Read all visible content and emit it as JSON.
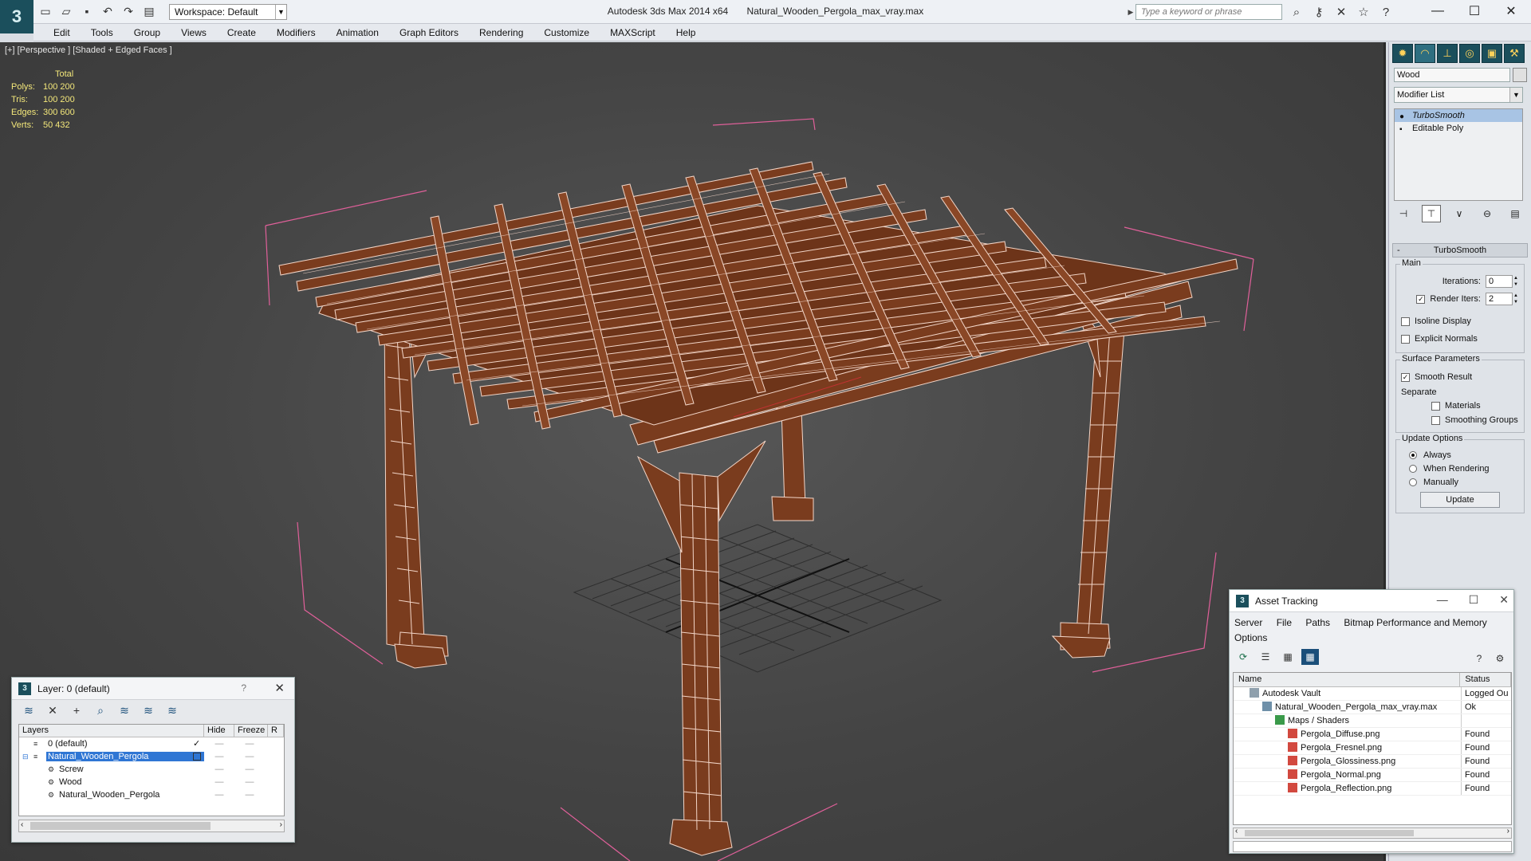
{
  "app": {
    "title": "Autodesk 3ds Max  2014 x64",
    "file_name": "Natural_Wooden_Pergola_max_vray.max",
    "workspace": "Workspace: Default",
    "search_placeholder": "Type a keyword or phrase"
  },
  "menu": [
    "Edit",
    "Tools",
    "Group",
    "Views",
    "Create",
    "Modifiers",
    "Animation",
    "Graph Editors",
    "Rendering",
    "Customize",
    "MAXScript",
    "Help"
  ],
  "viewport": {
    "label": "[+] [Perspective ] [Shaded + Edged Faces ]",
    "stats_header": "Total",
    "stats": [
      {
        "key": "Polys:",
        "value": "100 200"
      },
      {
        "key": "Tris:",
        "value": "100 200"
      },
      {
        "key": "Edges:",
        "value": "300 600"
      },
      {
        "key": "Verts:",
        "value": "50 432"
      }
    ]
  },
  "command_panel": {
    "object_name": "Wood",
    "modifier_list": "Modifier List",
    "stack": [
      {
        "label": "TurboSmooth",
        "selected": true
      },
      {
        "label": "Editable Poly",
        "selected": false
      }
    ],
    "rollout_title": "TurboSmooth",
    "main_group": "Main",
    "iterations_label": "Iterations:",
    "iterations_value": "0",
    "render_iters_label": "Render Iters:",
    "render_iters_value": "2",
    "isoline_label": "Isoline Display",
    "explicit_normals_label": "Explicit Normals",
    "surface_group": "Surface Parameters",
    "smooth_result_label": "Smooth Result",
    "separate_label": "Separate",
    "materials_label": "Materials",
    "smoothing_groups_label": "Smoothing Groups",
    "update_group": "Update Options",
    "always_label": "Always",
    "when_rendering_label": "When Rendering",
    "manually_label": "Manually",
    "update_button": "Update"
  },
  "layer_dialog": {
    "title": "Layer: 0 (default)",
    "help": "?",
    "columns": [
      "Layers",
      "Hide",
      "Freeze",
      "R"
    ],
    "rows": [
      {
        "name": "0 (default)",
        "indent": 0
      },
      {
        "name": "Natural_Wooden_Pergola",
        "indent": 0
      },
      {
        "name": "Screw",
        "indent": 1
      },
      {
        "name": "Wood",
        "indent": 1
      },
      {
        "name": "Natural_Wooden_Pergola",
        "indent": 1
      }
    ]
  },
  "asset_tracking": {
    "title": "Asset Tracking",
    "menu": [
      "Server",
      "File",
      "Paths",
      "Bitmap Performance and Memory",
      "Options"
    ],
    "columns": [
      "Name",
      "Status"
    ],
    "rows": [
      {
        "name": "Autodesk Vault",
        "status": "Logged Ou",
        "indent": 1
      },
      {
        "name": "Natural_Wooden_Pergola_max_vray.max",
        "status": "Ok",
        "indent": 2
      },
      {
        "name": "Maps / Shaders",
        "status": "",
        "indent": 3
      },
      {
        "name": "Pergola_Diffuse.png",
        "status": "Found",
        "indent": 4
      },
      {
        "name": "Pergola_Fresnel.png",
        "status": "Found",
        "indent": 4
      },
      {
        "name": "Pergola_Glossiness.png",
        "status": "Found",
        "indent": 4
      },
      {
        "name": "Pergola_Normal.png",
        "status": "Found",
        "indent": 4
      },
      {
        "name": "Pergola_Reflection.png",
        "status": "Found",
        "indent": 4
      }
    ]
  },
  "colors": {
    "viewport_bg": "#454545",
    "wood": "#7a3c1e",
    "wire": "#f3d6c8",
    "bbox": "#e0609a",
    "stats_text": "#f3e77a",
    "selection": "#2f76d4"
  }
}
